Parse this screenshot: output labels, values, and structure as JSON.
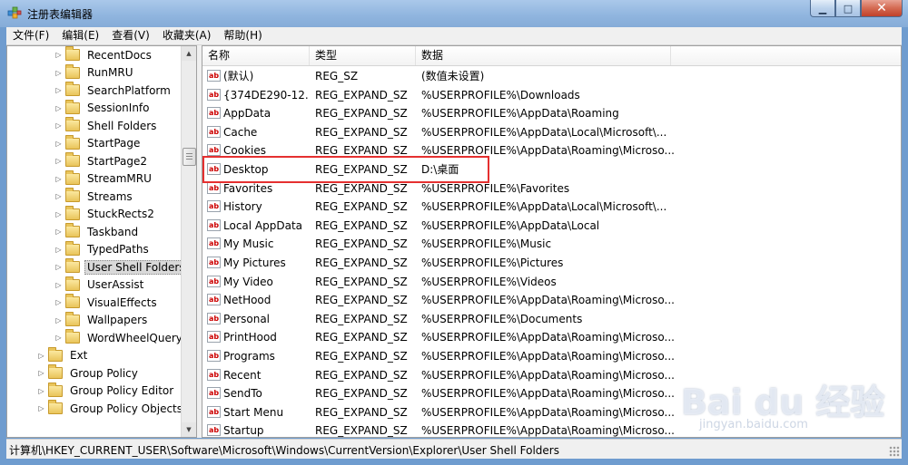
{
  "window": {
    "title": "注册表编辑器",
    "icon": "regedit-icon",
    "min_glyph": "▁",
    "max_glyph": "□",
    "close_glyph": "✕"
  },
  "menu": [
    "文件(F)",
    "编辑(E)",
    "查看(V)",
    "收藏夹(A)",
    "帮助(H)"
  ],
  "tree": {
    "items": [
      {
        "label": "RecentDocs",
        "level": 2
      },
      {
        "label": "RunMRU",
        "level": 2
      },
      {
        "label": "SearchPlatform",
        "level": 2
      },
      {
        "label": "SessionInfo",
        "level": 2
      },
      {
        "label": "Shell Folders",
        "level": 2
      },
      {
        "label": "StartPage",
        "level": 2
      },
      {
        "label": "StartPage2",
        "level": 2
      },
      {
        "label": "StreamMRU",
        "level": 2
      },
      {
        "label": "Streams",
        "level": 2
      },
      {
        "label": "StuckRects2",
        "level": 2
      },
      {
        "label": "Taskband",
        "level": 2
      },
      {
        "label": "TypedPaths",
        "level": 2
      },
      {
        "label": "User Shell Folders",
        "level": 2,
        "selected": true
      },
      {
        "label": "UserAssist",
        "level": 2
      },
      {
        "label": "VisualEffects",
        "level": 2
      },
      {
        "label": "Wallpapers",
        "level": 2
      },
      {
        "label": "WordWheelQuery",
        "level": 2
      },
      {
        "label": "Ext",
        "level": 1
      },
      {
        "label": "Group Policy",
        "level": 1
      },
      {
        "label": "Group Policy Editor",
        "level": 1
      },
      {
        "label": "Group Policy Objects",
        "level": 1
      }
    ]
  },
  "list": {
    "columns": [
      "名称",
      "类型",
      "数据"
    ],
    "rows": [
      {
        "name": "(默认)",
        "type": "REG_SZ",
        "data": "(数值未设置)"
      },
      {
        "name": "{374DE290-12...",
        "type": "REG_EXPAND_SZ",
        "data": "%USERPROFILE%\\Downloads"
      },
      {
        "name": "AppData",
        "type": "REG_EXPAND_SZ",
        "data": "%USERPROFILE%\\AppData\\Roaming"
      },
      {
        "name": "Cache",
        "type": "REG_EXPAND_SZ",
        "data": "%USERPROFILE%\\AppData\\Local\\Microsoft\\..."
      },
      {
        "name": "Cookies",
        "type": "REG_EXPAND_SZ",
        "data": "%USERPROFILE%\\AppData\\Roaming\\Microso..."
      },
      {
        "name": "Desktop",
        "type": "REG_EXPAND_SZ",
        "data": "D:\\桌面",
        "highlighted": true
      },
      {
        "name": "Favorites",
        "type": "REG_EXPAND_SZ",
        "data": "%USERPROFILE%\\Favorites"
      },
      {
        "name": "History",
        "type": "REG_EXPAND_SZ",
        "data": "%USERPROFILE%\\AppData\\Local\\Microsoft\\..."
      },
      {
        "name": "Local AppData",
        "type": "REG_EXPAND_SZ",
        "data": "%USERPROFILE%\\AppData\\Local"
      },
      {
        "name": "My Music",
        "type": "REG_EXPAND_SZ",
        "data": "%USERPROFILE%\\Music"
      },
      {
        "name": "My Pictures",
        "type": "REG_EXPAND_SZ",
        "data": "%USERPROFILE%\\Pictures"
      },
      {
        "name": "My Video",
        "type": "REG_EXPAND_SZ",
        "data": "%USERPROFILE%\\Videos"
      },
      {
        "name": "NetHood",
        "type": "REG_EXPAND_SZ",
        "data": "%USERPROFILE%\\AppData\\Roaming\\Microso..."
      },
      {
        "name": "Personal",
        "type": "REG_EXPAND_SZ",
        "data": "%USERPROFILE%\\Documents"
      },
      {
        "name": "PrintHood",
        "type": "REG_EXPAND_SZ",
        "data": "%USERPROFILE%\\AppData\\Roaming\\Microso..."
      },
      {
        "name": "Programs",
        "type": "REG_EXPAND_SZ",
        "data": "%USERPROFILE%\\AppData\\Roaming\\Microso..."
      },
      {
        "name": "Recent",
        "type": "REG_EXPAND_SZ",
        "data": "%USERPROFILE%\\AppData\\Roaming\\Microso..."
      },
      {
        "name": "SendTo",
        "type": "REG_EXPAND_SZ",
        "data": "%USERPROFILE%\\AppData\\Roaming\\Microso..."
      },
      {
        "name": "Start Menu",
        "type": "REG_EXPAND_SZ",
        "data": "%USERPROFILE%\\AppData\\Roaming\\Microso..."
      },
      {
        "name": "Startup",
        "type": "REG_EXPAND_SZ",
        "data": "%USERPROFILE%\\AppData\\Roaming\\Microso..."
      }
    ],
    "value_icon_text": "ab",
    "highlight_color": "#e53030"
  },
  "statusbar": {
    "path": "计算机\\HKEY_CURRENT_USER\\Software\\Microsoft\\Windows\\CurrentVersion\\Explorer\\User Shell Folders"
  },
  "watermark": {
    "main": "Bai du 经验",
    "sub": "jingyan.baidu.com"
  },
  "colors": {
    "accent": "#6f9ccf",
    "selection": "#d9d9d9"
  }
}
